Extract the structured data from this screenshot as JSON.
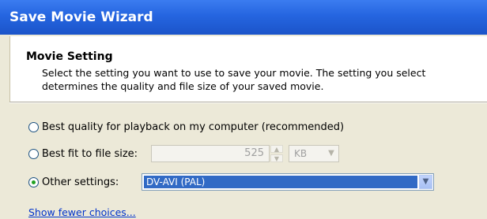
{
  "window": {
    "title": "Save Movie Wizard"
  },
  "header": {
    "title": "Movie Setting",
    "description": "Select the setting you want to use to save your movie. The setting you select determines the quality and file size of your saved movie."
  },
  "options": {
    "best_quality": {
      "label": "Best quality for playback on my computer (recommended)",
      "selected": false
    },
    "best_fit": {
      "label": "Best fit to file size:",
      "selected": false,
      "size_value": "525",
      "unit_value": "KB"
    },
    "other": {
      "label": "Other settings:",
      "selected": true,
      "value": "DV-AVI (PAL)"
    }
  },
  "link": {
    "label": "Show fewer choices..."
  },
  "icons": {
    "spin_up": "▲",
    "spin_down": "▼",
    "dropdown": "▼"
  }
}
